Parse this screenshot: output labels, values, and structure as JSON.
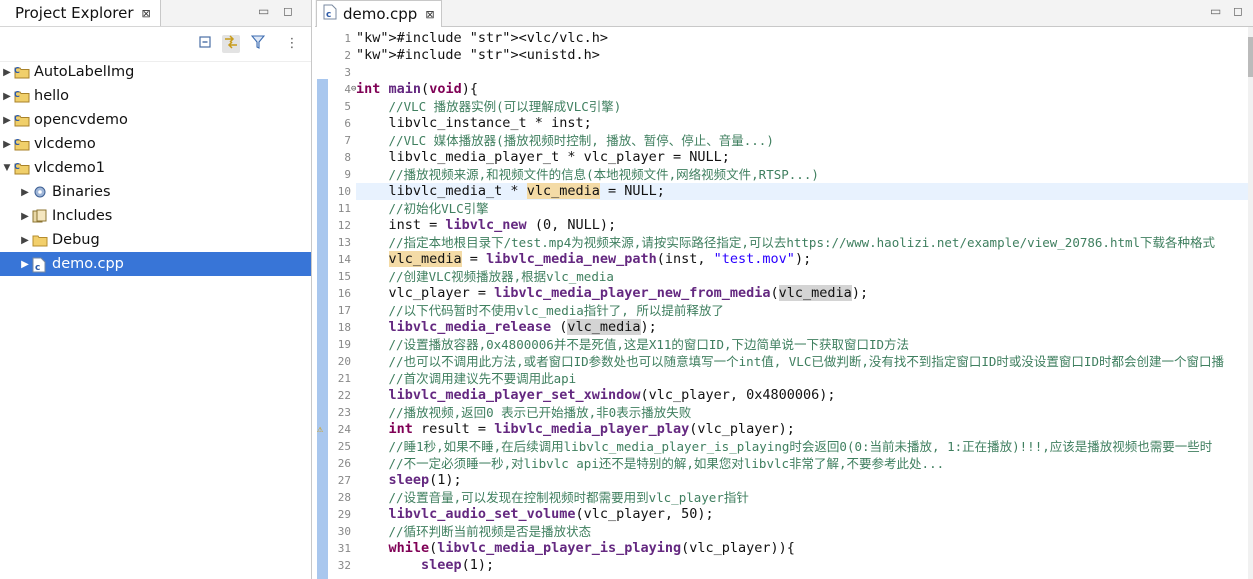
{
  "explorer": {
    "title": "Project Explorer",
    "close_glyph": "⊠",
    "minimize_glyph": "▭",
    "maximize_glyph": "◻",
    "toolbar_icons": [
      "collapse-all-icon",
      "link-with-editor-icon",
      "filter-icon",
      "view-menu-icon"
    ],
    "items": [
      {
        "label": "AutoLabelImg",
        "indent": 0,
        "expanded": false,
        "icon": "c-project-icon"
      },
      {
        "label": "hello",
        "indent": 0,
        "expanded": false,
        "icon": "c-project-icon"
      },
      {
        "label": "opencvdemo",
        "indent": 0,
        "expanded": false,
        "icon": "c-project-icon"
      },
      {
        "label": "vlcdemo",
        "indent": 0,
        "expanded": false,
        "icon": "c-project-icon"
      },
      {
        "label": "vlcdemo1",
        "indent": 0,
        "expanded": true,
        "icon": "c-project-icon"
      },
      {
        "label": "Binaries",
        "indent": 1,
        "expanded": false,
        "icon": "binaries-icon"
      },
      {
        "label": "Includes",
        "indent": 1,
        "expanded": false,
        "icon": "includes-icon"
      },
      {
        "label": "Debug",
        "indent": 1,
        "expanded": false,
        "icon": "folder-icon"
      },
      {
        "label": "demo.cpp",
        "indent": 1,
        "expanded": false,
        "icon": "cpp-file-icon",
        "selected": true
      }
    ]
  },
  "editor": {
    "tab_label": "demo.cpp",
    "tab_close_glyph": "⊠",
    "line_numbers": [
      "1",
      "2",
      "3",
      "4",
      "5",
      "6",
      "7",
      "8",
      "9",
      "10",
      "11",
      "12",
      "13",
      "14",
      "15",
      "16",
      "17",
      "18",
      "19",
      "20",
      "21",
      "22",
      "23",
      "24",
      "25",
      "26",
      "27",
      "28",
      "29",
      "30",
      "31",
      "32"
    ],
    "current_line": 10,
    "lines": [
      "#include <vlc/vlc.h>",
      "#include <unistd.h>",
      "",
      "int main(void){",
      "    //VLC 播放器实例(可以理解成VLC引擎)",
      "    libvlc_instance_t * inst;",
      "    //VLC 媒体播放器(播放视频时控制, 播放、暂停、停止、音量...)",
      "    libvlc_media_player_t * vlc_player = NULL;",
      "    //播放视频来源,和视频文件的信息(本地视频文件,网络视频文件,RTSP...)",
      "    libvlc_media_t * vlc_media = NULL;",
      "    //初始化VLC引擎",
      "    inst = libvlc_new (0, NULL);",
      "    //指定本地根目录下/test.mp4为视频来源,请按实际路径指定,可以去https://www.haolizi.net/example/view_20786.html下载各种格式",
      "    vlc_media = libvlc_media_new_path(inst, \"test.mov\");",
      "    //创建VLC视频播放器,根据vlc_media",
      "    vlc_player = libvlc_media_player_new_from_media(vlc_media);",
      "    //以下代码暂时不使用vlc_media指针了, 所以提前释放了",
      "    libvlc_media_release (vlc_media);",
      "    //设置播放容器,0x4800006并不是死值,这是X11的窗口ID,下边简单说一下获取窗口ID方法",
      "    //也可以不调用此方法,或者窗口ID参数处也可以随意填写一个int值, VLC已做判断,没有找不到指定窗口ID时或没设置窗口ID时都会创建一个窗口播",
      "    //首次调用建议先不要调用此api",
      "    libvlc_media_player_set_xwindow(vlc_player, 0x4800006);",
      "    //播放视频,返回0 表示已开始播放,非0表示播放失败",
      "    int result = libvlc_media_player_play(vlc_player);",
      "    //睡1秒,如果不睡,在后续调用libvlc_media_player_is_playing时会返回0(0:当前未播放, 1:正在播放)!!!,应该是播放视频也需要一些时",
      "    //不一定必须睡一秒,对libvlc api还不是特别的解,如果您对libvlc非常了解,不要参考此处...",
      "    sleep(1);",
      "    //设置音量,可以发现在控制视频时都需要用到vlc_player指针",
      "    libvlc_audio_set_volume(vlc_player, 50);",
      "    //循环判断当前视频是否是播放状态",
      "    while(libvlc_media_player_is_playing(vlc_player)){",
      "        sleep(1);"
    ]
  }
}
